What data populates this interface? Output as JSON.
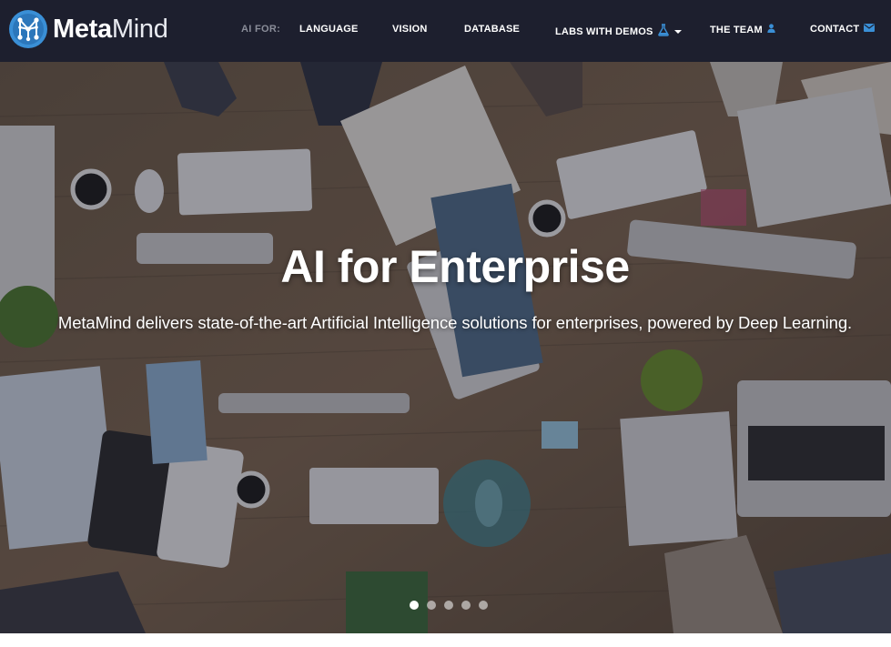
{
  "brand": {
    "name_bold": "Meta",
    "name_light": "Mind"
  },
  "nav": {
    "prefix": "AI FOR:",
    "items": [
      {
        "label": "LANGUAGE"
      },
      {
        "label": "VISION"
      },
      {
        "label": "DATABASE"
      },
      {
        "label": "LABS WITH DEMOS",
        "icon": "flask-icon",
        "dropdown": true
      },
      {
        "label": "THE TEAM",
        "icon": "user-icon"
      },
      {
        "label": "CONTACT",
        "icon": "envelope-icon"
      }
    ]
  },
  "hero": {
    "title": "AI for Enterprise",
    "subtitle": "MetaMind delivers state-of-the-art Artificial Intelligence solutions for enterprises, powered by Deep Learning.",
    "slides_count": 5,
    "active_slide": 1
  },
  "colors": {
    "navbar_bg": "#1d1f2e",
    "accent_blue": "#3a8fd6",
    "nav_prefix": "#8a8d99",
    "text_white": "#ffffff"
  }
}
